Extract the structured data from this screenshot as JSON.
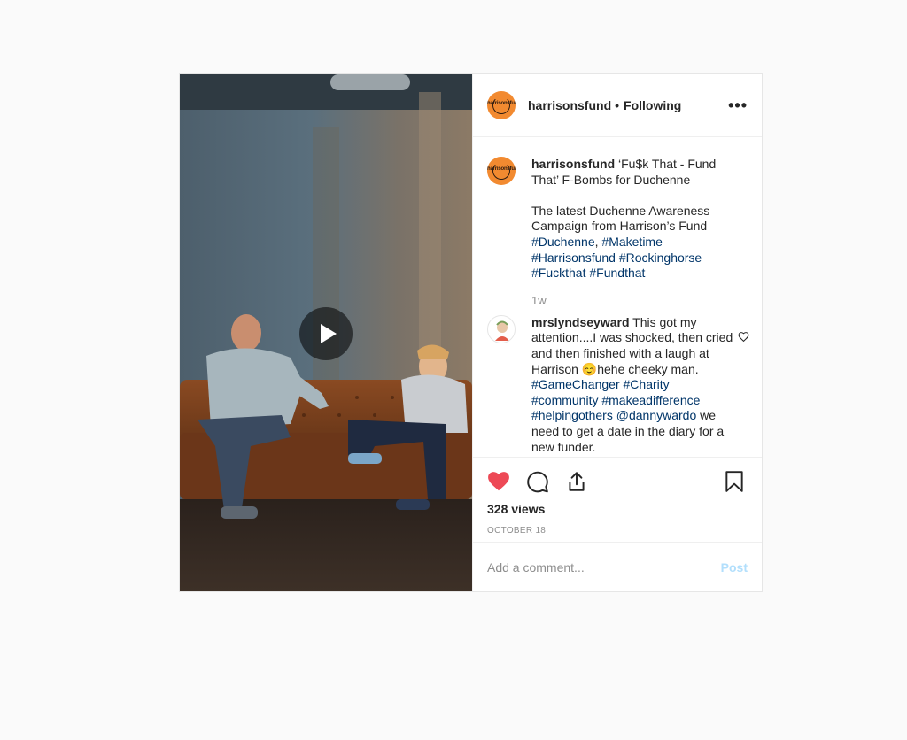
{
  "post": {
    "username": "harrisonsfund",
    "following_label": "Following",
    "dot": "•",
    "more_label": "•••",
    "avatar_text": "harrisonsfund",
    "caption": {
      "username": "harrisonsfund",
      "line1": "‘Fu$k That - Fund That’ F-Bombs for Duchenne",
      "line2": "The latest Duchenne Awareness Campaign from Harrison’s Fund",
      "tags": [
        "#Duchenne",
        "#Maketime",
        "#Harrisonsfund",
        "#Rockinghorse",
        "#Fuckthat",
        "#Fundthat"
      ]
    },
    "time_ago": "1w",
    "comment": {
      "username": "mrslyndseyward",
      "text_before": "This got my attention....I was shocked, then cried and then finished with a laugh at Harrison ☺️hehe cheeky man.",
      "tags": [
        "#GameChanger",
        "#Charity",
        "#community",
        "#makeadifference",
        "#helpingothers"
      ],
      "mention": "@dannywardo",
      "text_after": "we need to get a date in the diary for a new funder."
    },
    "views": "328 views",
    "date": "OCTOBER 18",
    "add_comment_placeholder": "Add a comment...",
    "post_button": "Post"
  },
  "colors": {
    "brand_orange": "#f28a30",
    "like_red": "#ed4956",
    "link_blue": "#003569",
    "post_disabled": "#b2dffc"
  },
  "icons": {
    "like": "heart-filled-icon",
    "comment": "comment-bubble-icon",
    "share": "share-upload-icon",
    "save": "bookmark-icon",
    "play": "play-icon"
  }
}
